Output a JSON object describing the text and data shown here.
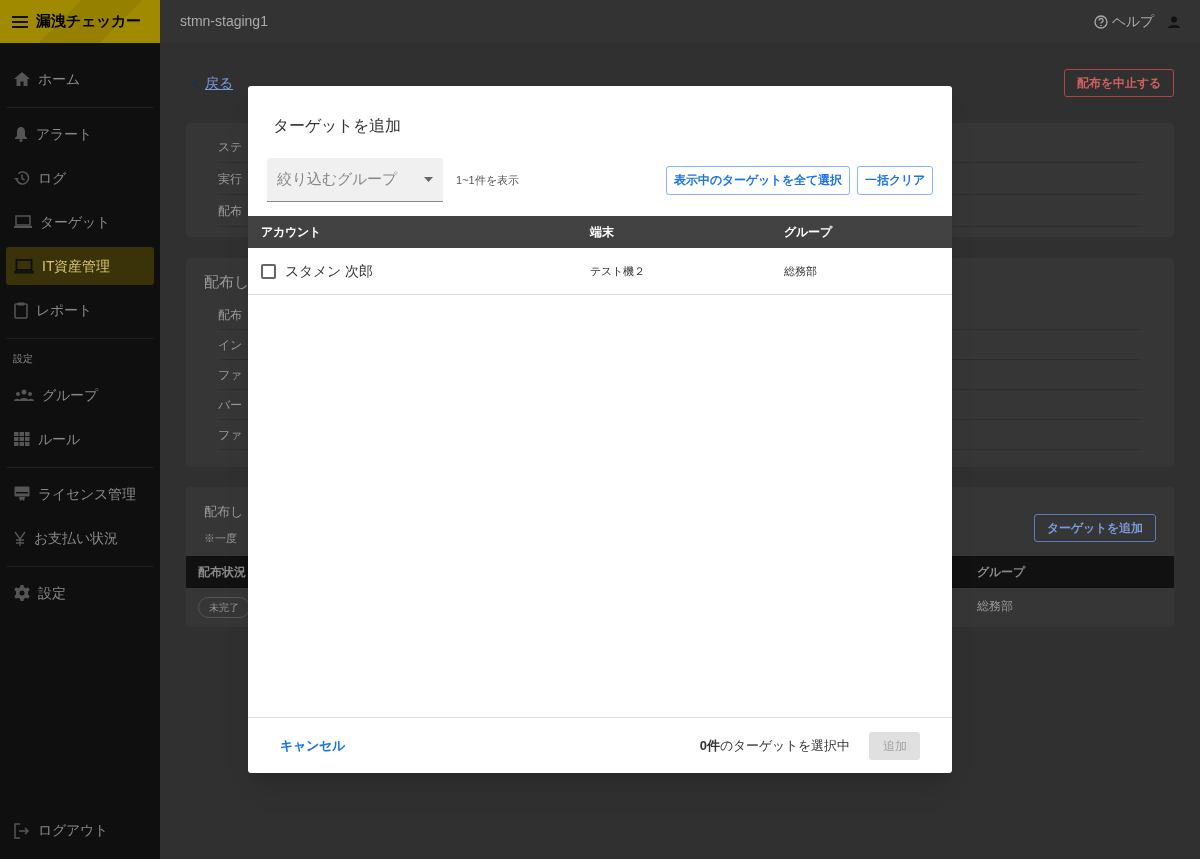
{
  "app": {
    "title": "漏洩チェッカー",
    "workspace": "stmn-staging1",
    "help": "ヘルプ"
  },
  "sidebar": {
    "sections": [
      {
        "items": [
          {
            "label": "ホーム",
            "selected": false
          }
        ]
      },
      {
        "items": [
          {
            "label": "アラート",
            "selected": false
          },
          {
            "label": "ログ",
            "selected": false
          },
          {
            "label": "ターゲット",
            "selected": false
          },
          {
            "label": "IT資産管理",
            "selected": true
          },
          {
            "label": "レポート",
            "selected": false
          }
        ]
      },
      {
        "heading": "設定",
        "items": [
          {
            "label": "グループ",
            "selected": false
          },
          {
            "label": "ルール",
            "selected": false
          }
        ]
      },
      {
        "items": [
          {
            "label": "ライセンス管理",
            "selected": false
          },
          {
            "label": "お支払い状況",
            "selected": false
          }
        ]
      },
      {
        "items": [
          {
            "label": "設定",
            "selected": false
          }
        ]
      }
    ],
    "logout": "ログアウト"
  },
  "page": {
    "back": "戻る",
    "stop_button": "配布を中止する",
    "summary_rows": [
      "ステ",
      "実行",
      "配布"
    ],
    "detail_card": {
      "title": "配布し",
      "rows": [
        "配布",
        "イン",
        "ファ",
        "バー",
        "ファ"
      ]
    },
    "targets_card": {
      "title": "配布し",
      "note": "※一度",
      "add_button": "ターゲットを追加",
      "columns": [
        "配布状況",
        "グループ"
      ],
      "rows": [
        {
          "status": "未完了",
          "group": "総務部"
        }
      ]
    }
  },
  "dialog": {
    "title": "ターゲットを追加",
    "filter": {
      "placeholder": "絞り込むグループ"
    },
    "count": "1~1件を表示",
    "buttons": [
      "表示中のターゲットを全て選択",
      "一括クリア"
    ],
    "columns": [
      "アカウント",
      "端末",
      "グループ"
    ],
    "rows": [
      {
        "account": "スタメン 次郎",
        "checked": false,
        "device": "テスト機２",
        "group": "総務部"
      }
    ],
    "cancel": "キャンセル",
    "selection": "**0件**のターゲットを選択中",
    "add": {
      "label": "追加",
      "disabled": true
    }
  }
}
